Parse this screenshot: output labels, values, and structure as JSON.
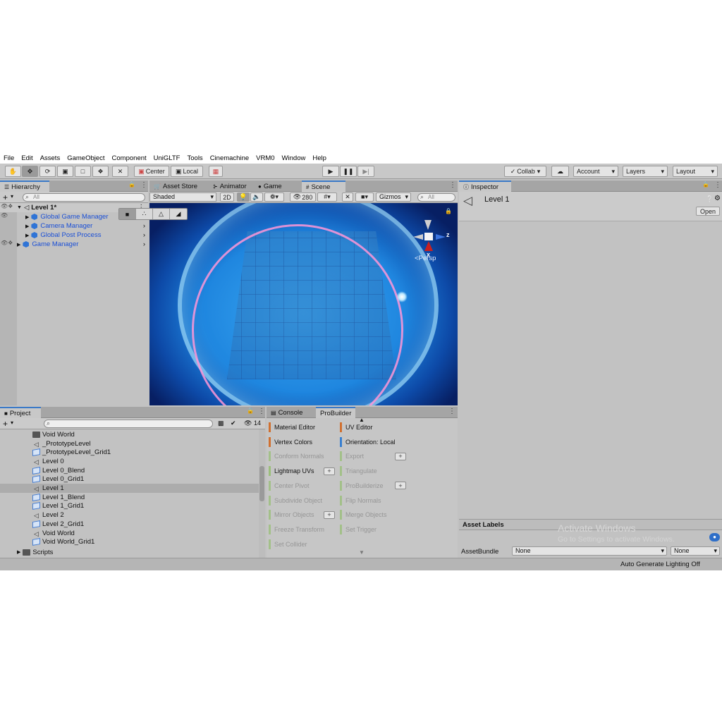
{
  "menu": [
    "File",
    "Edit",
    "Assets",
    "GameObject",
    "Component",
    "UniGLTF",
    "Tools",
    "Cinemachine",
    "VRM0",
    "Window",
    "Help"
  ],
  "toolbar": {
    "pivot_center": "Center",
    "pivot_local": "Local",
    "collab": "Collab",
    "account": "Account",
    "layers": "Layers",
    "layout": "Layout"
  },
  "hierarchy": {
    "tab": "Hierarchy",
    "add": "+",
    "search_placeholder": "All",
    "scene_name": "Level 1*",
    "items": [
      "Global Game Manager",
      "Camera Manager",
      "Global Post Process",
      "Game Manager"
    ]
  },
  "center_tabs": [
    "Asset Store",
    "Animator",
    "Game",
    "Scene"
  ],
  "scene_bar": {
    "shading": "Shaded",
    "mode_2d": "2D",
    "hidden_count": "280",
    "gizmos": "Gizmos",
    "search_placeholder": "All",
    "axis_z": "z",
    "axis_x": "x",
    "projection": "Persp"
  },
  "project": {
    "tab": "Project",
    "add": "+",
    "badge_count": "14",
    "items": [
      {
        "name": "Void World",
        "kind": "folder"
      },
      {
        "name": "_PrototypeLevel",
        "kind": "scene"
      },
      {
        "name": "_PrototypeLevel_Grid1",
        "kind": "prefab"
      },
      {
        "name": "Level 0",
        "kind": "scene"
      },
      {
        "name": "Level 0_Blend",
        "kind": "prefab"
      },
      {
        "name": "Level 0_Grid1",
        "kind": "prefab"
      },
      {
        "name": "Level 1",
        "kind": "scene",
        "selected": true
      },
      {
        "name": "Level 1_Blend",
        "kind": "prefab"
      },
      {
        "name": "Level 1_Grid1",
        "kind": "prefab"
      },
      {
        "name": "Level 2",
        "kind": "scene"
      },
      {
        "name": "Level 2_Grid1",
        "kind": "prefab"
      },
      {
        "name": "Void World",
        "kind": "scene"
      },
      {
        "name": "Void World_Grid1",
        "kind": "prefab"
      }
    ],
    "scripts_folder": "Scripts"
  },
  "lower_tabs": [
    "Console",
    "ProBuilder"
  ],
  "probuilder": {
    "left": [
      {
        "label": "Material Editor",
        "color": "#d07030",
        "dim": false
      },
      {
        "label": "Vertex Colors",
        "color": "#d07030",
        "dim": false
      },
      {
        "label": "Conform Normals",
        "color": "#9bbf7a",
        "dim": true
      },
      {
        "label": "Lightmap UVs",
        "color": "#9bbf7a",
        "dim": false,
        "plus": true
      },
      {
        "label": "Center Pivot",
        "color": "#9bbf7a",
        "dim": true
      },
      {
        "label": "Subdivide Object",
        "color": "#9bbf7a",
        "dim": true
      },
      {
        "label": "Mirror Objects",
        "color": "#9bbf7a",
        "dim": true,
        "plus": true
      },
      {
        "label": "Freeze Transform",
        "color": "#9bbf7a",
        "dim": true
      },
      {
        "label": "Set Collider",
        "color": "#9bbf7a",
        "dim": true
      }
    ],
    "right": [
      {
        "label": "UV Editor",
        "color": "#d07030",
        "dim": false
      },
      {
        "label": "Orientation: Local",
        "color": "#3a80d0",
        "dim": false
      },
      {
        "label": "Export",
        "color": "#9bbf7a",
        "dim": true,
        "plus": true
      },
      {
        "label": "Triangulate",
        "color": "#9bbf7a",
        "dim": true
      },
      {
        "label": "ProBuilderize",
        "color": "#9bbf7a",
        "dim": true,
        "plus": true
      },
      {
        "label": "Flip Normals",
        "color": "#9bbf7a",
        "dim": true
      },
      {
        "label": "Merge Objects",
        "color": "#9bbf7a",
        "dim": true
      },
      {
        "label": "Set Trigger",
        "color": "#9bbf7a",
        "dim": true
      }
    ]
  },
  "inspector": {
    "tab": "Inspector",
    "object_name": "Level 1",
    "open_button": "Open",
    "asset_labels": "Asset Labels",
    "asset_bundle_label": "AssetBundle",
    "asset_bundle_value": "None",
    "asset_variant_value": "None",
    "watermark_title": "Activate Windows",
    "watermark_sub": "Go to Settings to activate Windows."
  },
  "status": {
    "lighting": "Auto Generate Lighting Off"
  }
}
